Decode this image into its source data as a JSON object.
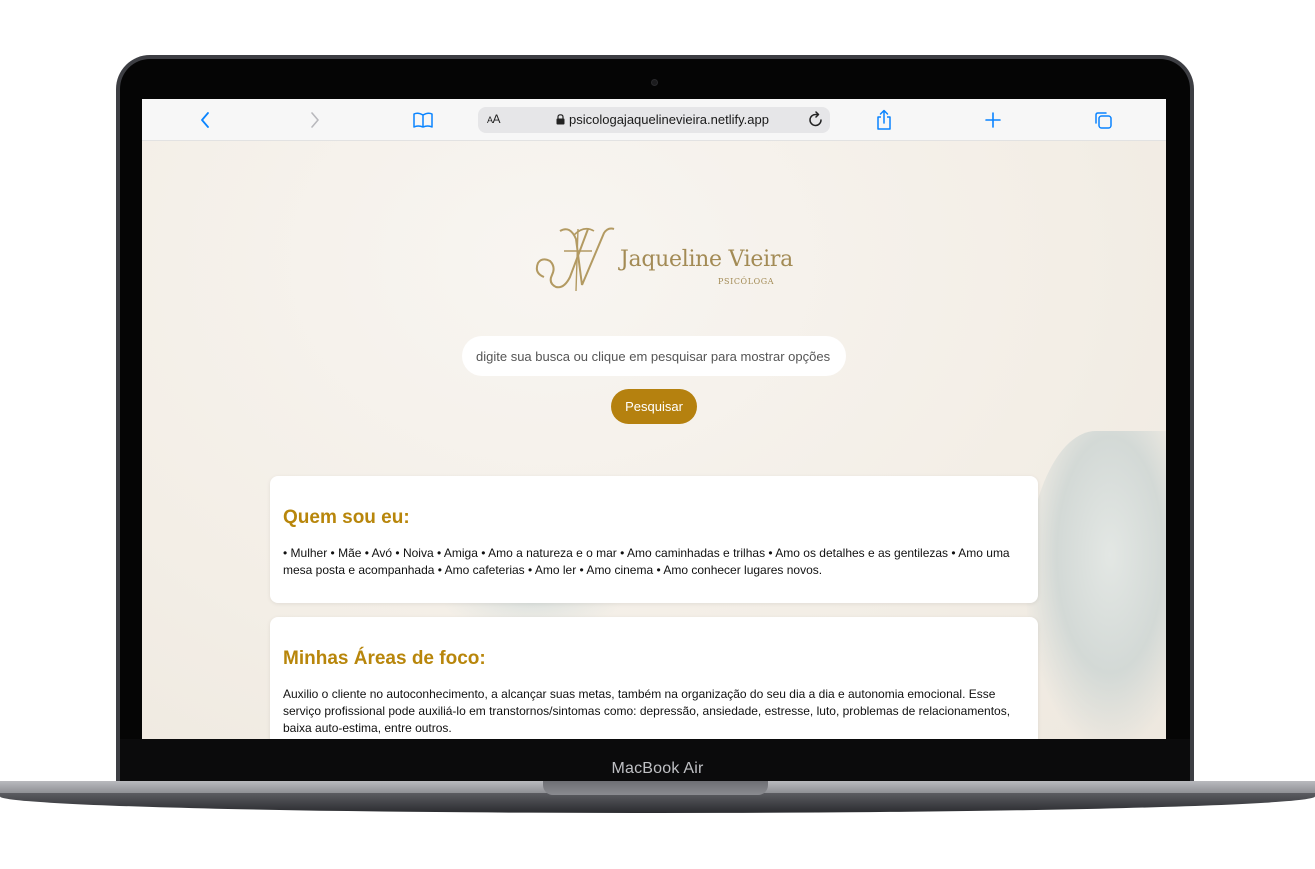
{
  "device": {
    "model_label": "MacBook Air"
  },
  "browser": {
    "address_prefix": "AA",
    "url": "psicologajaquelinevieira.netlify.app",
    "buttons": {
      "back_icon": "chevron-left-icon",
      "forward_icon": "chevron-right-icon",
      "bookmarks_icon": "book-icon",
      "share_icon": "share-icon",
      "new_tab_icon": "plus-icon",
      "tabs_icon": "tabs-icon"
    },
    "accent_color": "#0a84ff"
  },
  "page": {
    "logo": {
      "name": "Jaqueline Vieira",
      "subtitle": "PSICÓLOGA",
      "color": "#a38b55"
    },
    "search": {
      "placeholder": "digite sua busca ou clique em pesquisar para mostrar opções",
      "button_label": "Pesquisar",
      "button_color": "#b5810f"
    },
    "sections": [
      {
        "title": "Quem sou eu:",
        "text": "• Mulher • Mãe • Avó • Noiva • Amiga • Amo a natureza e o mar • Amo caminhadas e trilhas • Amo os detalhes e as gentilezas • Amo uma mesa posta e acompanhada • Amo cafeterias • Amo ler • Amo cinema • Amo conhecer lugares novos."
      },
      {
        "title": "Minhas Áreas de foco:",
        "text": "Auxilio o cliente no autoconhecimento, a alcançar suas metas, também na organização do seu dia a dia e autonomia emocional. Esse serviço profissional pode auxiliá-lo em transtornos/sintomas como: depressão, ansiedade, estresse, luto, problemas de relacionamentos, baixa auto-estima, entre outros."
      }
    ],
    "heading_color": "#b8860b"
  }
}
